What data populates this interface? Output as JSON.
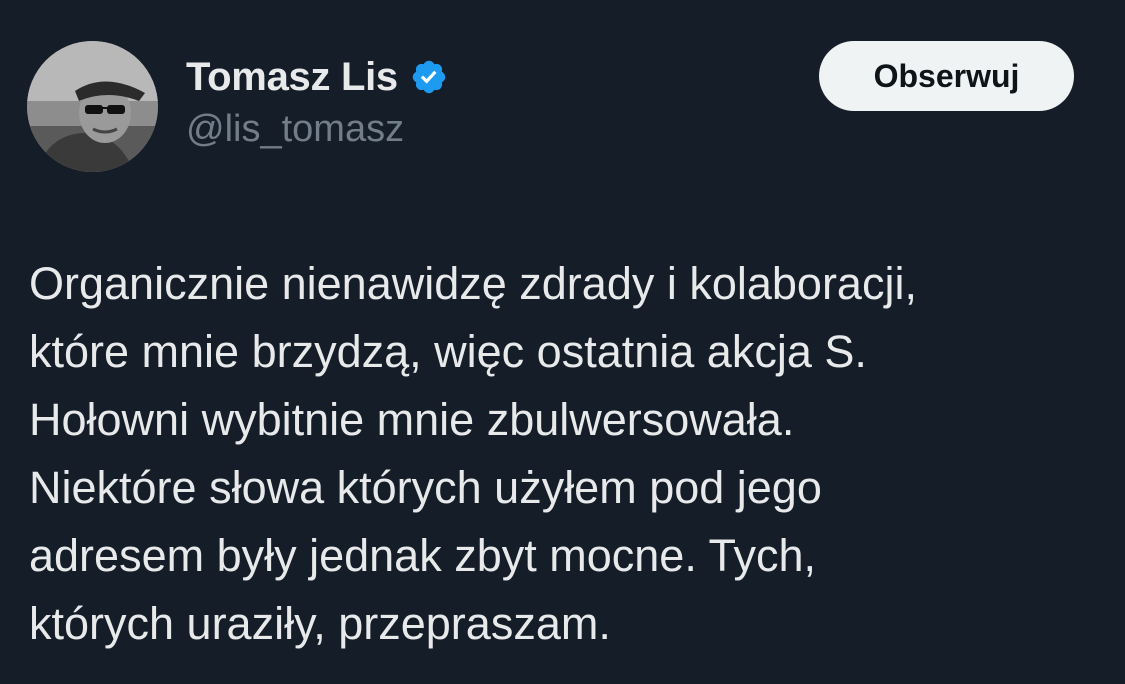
{
  "author": {
    "display_name": "Tomasz Lis",
    "handle": "@lis_tomasz",
    "verified": true,
    "verified_color": "#1d9bf0"
  },
  "actions": {
    "follow_label": "Obserwuj"
  },
  "tweet": {
    "lines": [
      "Organicznie nienawidzę zdrady i kolaboracji,",
      "które mnie brzydzą, więc ostatnia akcja S.",
      "Hołowni wybitnie mnie zbulwersowała.",
      "Niektóre słowa których użyłem pod jego",
      "adresem były jednak zbyt mocne. Tych,",
      "których uraziły, przepraszam."
    ]
  },
  "colors": {
    "background": "#151d28",
    "text": "#e7e9ea",
    "secondary_text": "#717d89",
    "button_bg": "#eff3f4",
    "button_text": "#0f1419"
  }
}
